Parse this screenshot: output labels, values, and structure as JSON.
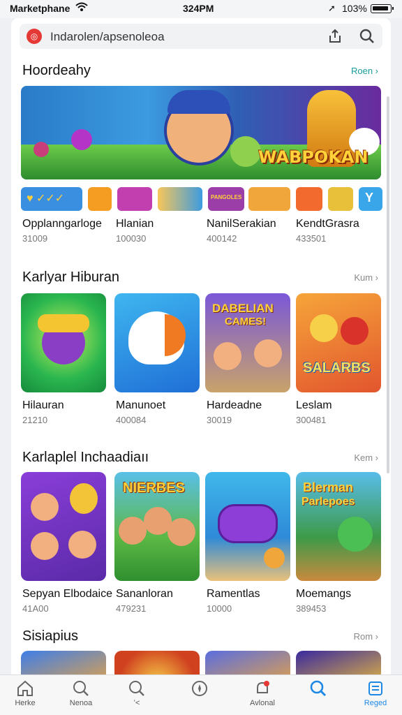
{
  "status_bar": {
    "carrier": "Marketphane",
    "time": "324PM",
    "battery": "103%"
  },
  "search": {
    "query": "Indarolen/apsenoleoa"
  },
  "sections": [
    {
      "title": "Hoordeahy",
      "more": "Roen",
      "items": [
        {
          "label": "Opplanngarloge",
          "sub": "31009"
        },
        {
          "label": "Hlanian",
          "sub": "100030"
        },
        {
          "label": "NanilSerakian",
          "sub": "400142"
        },
        {
          "label": "KendtGrasra",
          "sub": "433501"
        }
      ]
    },
    {
      "title": "Karlyar Hiburan",
      "more": "Kum",
      "items": [
        {
          "label": "Hilauran",
          "sub": "21210"
        },
        {
          "label": "Manunoet",
          "sub": "400084"
        },
        {
          "label": "Hardeadne",
          "sub": "30019"
        },
        {
          "label": "Leslam",
          "sub": "300481"
        }
      ]
    },
    {
      "title": "Karlaplel Inchaadiaıı",
      "more": "Kem",
      "items": [
        {
          "label": "Sepyan Elbodaice",
          "sub": "41A00"
        },
        {
          "label": "Sananloran",
          "sub": "479231"
        },
        {
          "label": "Ramentlas",
          "sub": "10000"
        },
        {
          "label": "Moemangs",
          "sub": "389453"
        }
      ]
    },
    {
      "title": "Sisiapius",
      "more": "Rom"
    }
  ],
  "banner_text": "WABPOKAN",
  "tile_texts": {
    "dabelian_title": "DABELIAN",
    "dabelian_sub": "CAMES!",
    "salarbs": "SALARBS",
    "nierees": "NIERBES",
    "blerman_1": "Blerman",
    "blerman_2": "Parlepoes"
  },
  "chip_texts": {
    "tabs_chip": "PANGOLES"
  },
  "nav": [
    {
      "label": "Herke",
      "icon": "home-icon"
    },
    {
      "label": "Nenoa",
      "icon": "search-icon"
    },
    {
      "label": "ʻ<",
      "icon": "search-icon"
    },
    {
      "label": "",
      "icon": "compass-icon"
    },
    {
      "label": "Avlonal",
      "icon": "bell-icon"
    },
    {
      "label": "",
      "icon": "search-icon"
    },
    {
      "label": "Reged",
      "icon": "apps-icon"
    }
  ],
  "colors": {
    "accent": "#1e88e5",
    "teal": "#1a9c9a",
    "brand_red": "#e53935"
  }
}
